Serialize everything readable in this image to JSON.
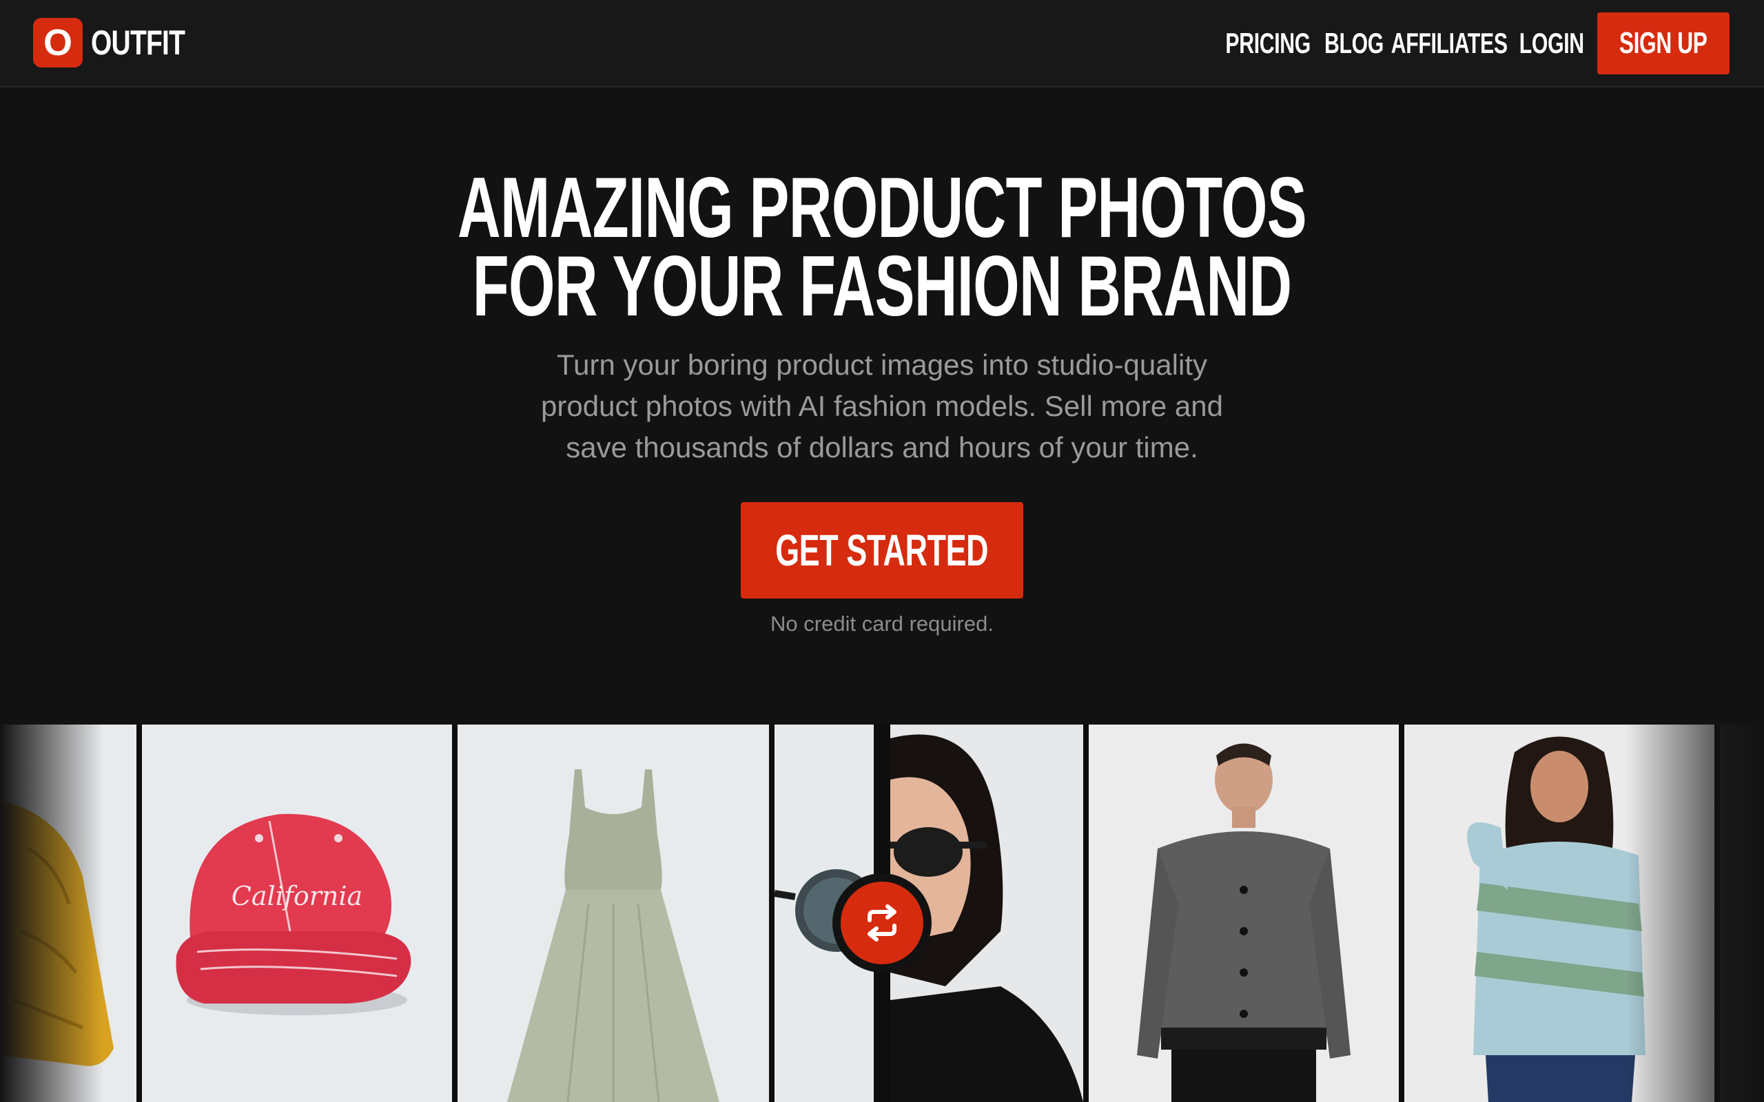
{
  "brand": {
    "logo_letter": "O",
    "name": "OUTFIT",
    "accent": "#d62b0e"
  },
  "nav": {
    "links": [
      "PRICING",
      "BLOG",
      "AFFILIATES",
      "LOGIN"
    ],
    "signup": "SIGN UP"
  },
  "hero": {
    "title_line1": "AMAZING PRODUCT PHOTOS",
    "title_line2": "FOR YOUR FASHION BRAND",
    "subtitle": "Turn your boring product images into studio-quality product photos with AI fashion models. Sell more and save thousands of dollars and hours of your time.",
    "cta": "GET STARTED",
    "cta_note": "No credit card required."
  },
  "gallery": {
    "items": [
      "yellow-puffer-jacket",
      "red-california-cap",
      "sage-dress",
      "sunglasses",
      "model-sunglasses",
      "model-tweed-jacket",
      "model-knit-sweater"
    ],
    "cap_text": "California"
  },
  "icons": {
    "swap": "swap-arrows-icon"
  }
}
